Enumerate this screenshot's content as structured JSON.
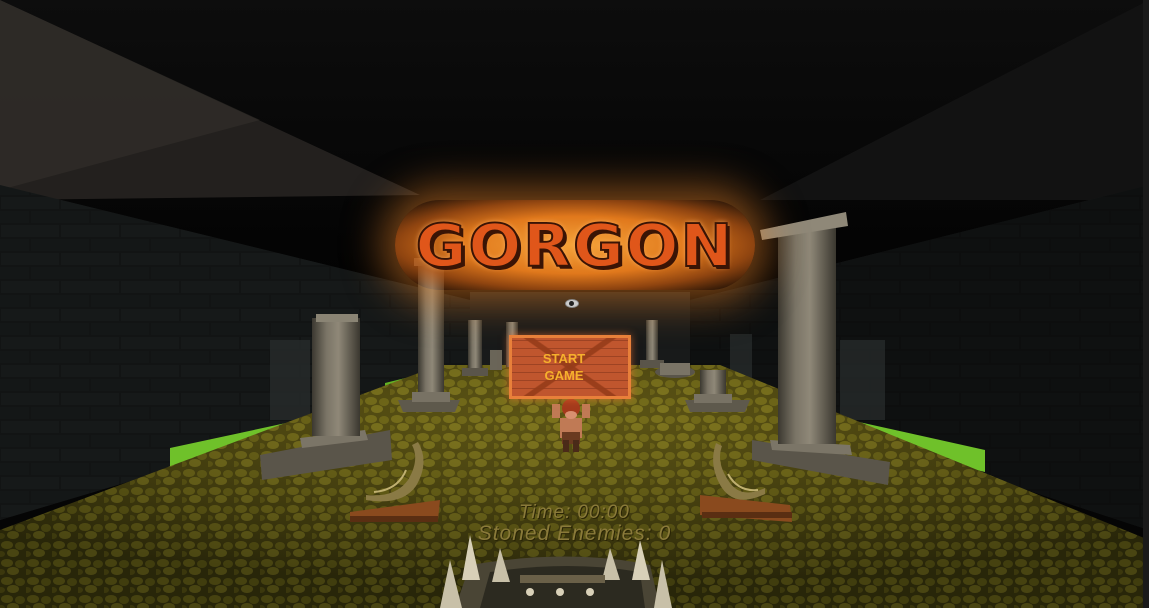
{
  "game": {
    "title": "GORGON",
    "menu": {
      "start_line1": "START",
      "start_line2": "GAME"
    },
    "hud": {
      "time_label": "Time:",
      "time_value": "00:00",
      "stoned_label": "Stoned Enemies:",
      "stoned_value": "0"
    }
  },
  "colors": {
    "title_glow": "#e0781c",
    "title_text": "#e0561a",
    "button_face": "#c0562e",
    "button_text": "#f6b02c",
    "hud_text": "#8a7a3a",
    "floor": "#5a5514",
    "grass": "#6fc12a",
    "wall": "#1b1d1d"
  },
  "icons": {
    "enemy_marker": "eye-icon",
    "weapon": "spiked-shield"
  }
}
